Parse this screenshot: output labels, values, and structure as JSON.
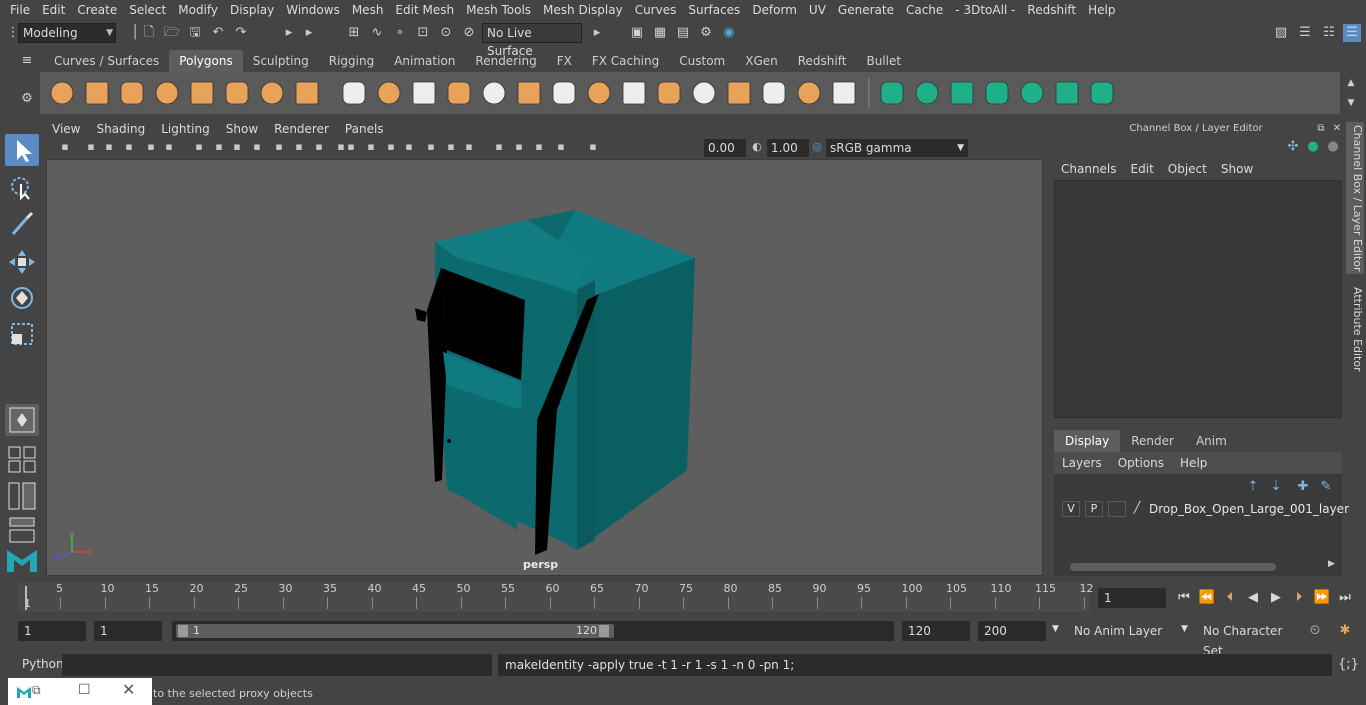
{
  "menubar": [
    "File",
    "Edit",
    "Create",
    "Select",
    "Modify",
    "Display",
    "Windows",
    "Mesh",
    "Edit Mesh",
    "Mesh Tools",
    "Mesh Display",
    "Curves",
    "Surfaces",
    "Deform",
    "UV",
    "Generate",
    "Cache",
    "- 3DtoAll -",
    "Redshift",
    "Help"
  ],
  "status": {
    "mode": "Modeling",
    "live_surface": "No Live Surface"
  },
  "shelf_tabs": [
    "Curves / Surfaces",
    "Polygons",
    "Sculpting",
    "Rigging",
    "Animation",
    "Rendering",
    "FX",
    "FX Caching",
    "Custom",
    "XGen",
    "Redshift",
    "Bullet"
  ],
  "shelf_active": "Polygons",
  "panel_menu": [
    "View",
    "Shading",
    "Lighting",
    "Show",
    "Renderer",
    "Panels"
  ],
  "panel_bar": {
    "exposure": "0.00",
    "gamma": "1.00",
    "color_space": "sRGB gamma"
  },
  "viewport": {
    "camera": "persp",
    "axis_x": "x",
    "axis_y": "y",
    "axis_z": "z"
  },
  "channel_box": {
    "title": "Channel Box / Layer Editor",
    "menu": [
      "Channels",
      "Edit",
      "Object",
      "Show"
    ]
  },
  "side_tabs": [
    "Channel Box / Layer Editor",
    "Attribute Editor"
  ],
  "layer_tabs": [
    "Display",
    "Render",
    "Anim"
  ],
  "layer_menu": [
    "Layers",
    "Options",
    "Help"
  ],
  "layer": {
    "v": "V",
    "p": "P",
    "name": "Drop_Box_Open_Large_001_layer"
  },
  "timeline": {
    "ticks": [
      "5",
      "10",
      "15",
      "20",
      "25",
      "30",
      "35",
      "40",
      "45",
      "50",
      "55",
      "60",
      "65",
      "70",
      "75",
      "80",
      "85",
      "90",
      "95",
      "100",
      "105",
      "110",
      "115",
      "12"
    ],
    "start_label": "1",
    "current_frame": "1"
  },
  "range": {
    "start": "1",
    "playback_start": "1",
    "slider_start": "1",
    "slider_end": "120",
    "playback_end": "120",
    "end": "200",
    "anim_layer": "No Anim Layer",
    "character_set": "No Character Set"
  },
  "command": {
    "label": "Python",
    "output": "makeIdentity -apply true -t 1 -r 1 -s 1 -n 0 -pn 1;"
  },
  "help": {
    "text": "to the selected proxy objects"
  },
  "colors": {
    "accent": "#5a8bc4",
    "model": "#0c6a6e",
    "shelf_icon": "#e8a25a",
    "shelf_icon_green": "#1fb08a"
  }
}
